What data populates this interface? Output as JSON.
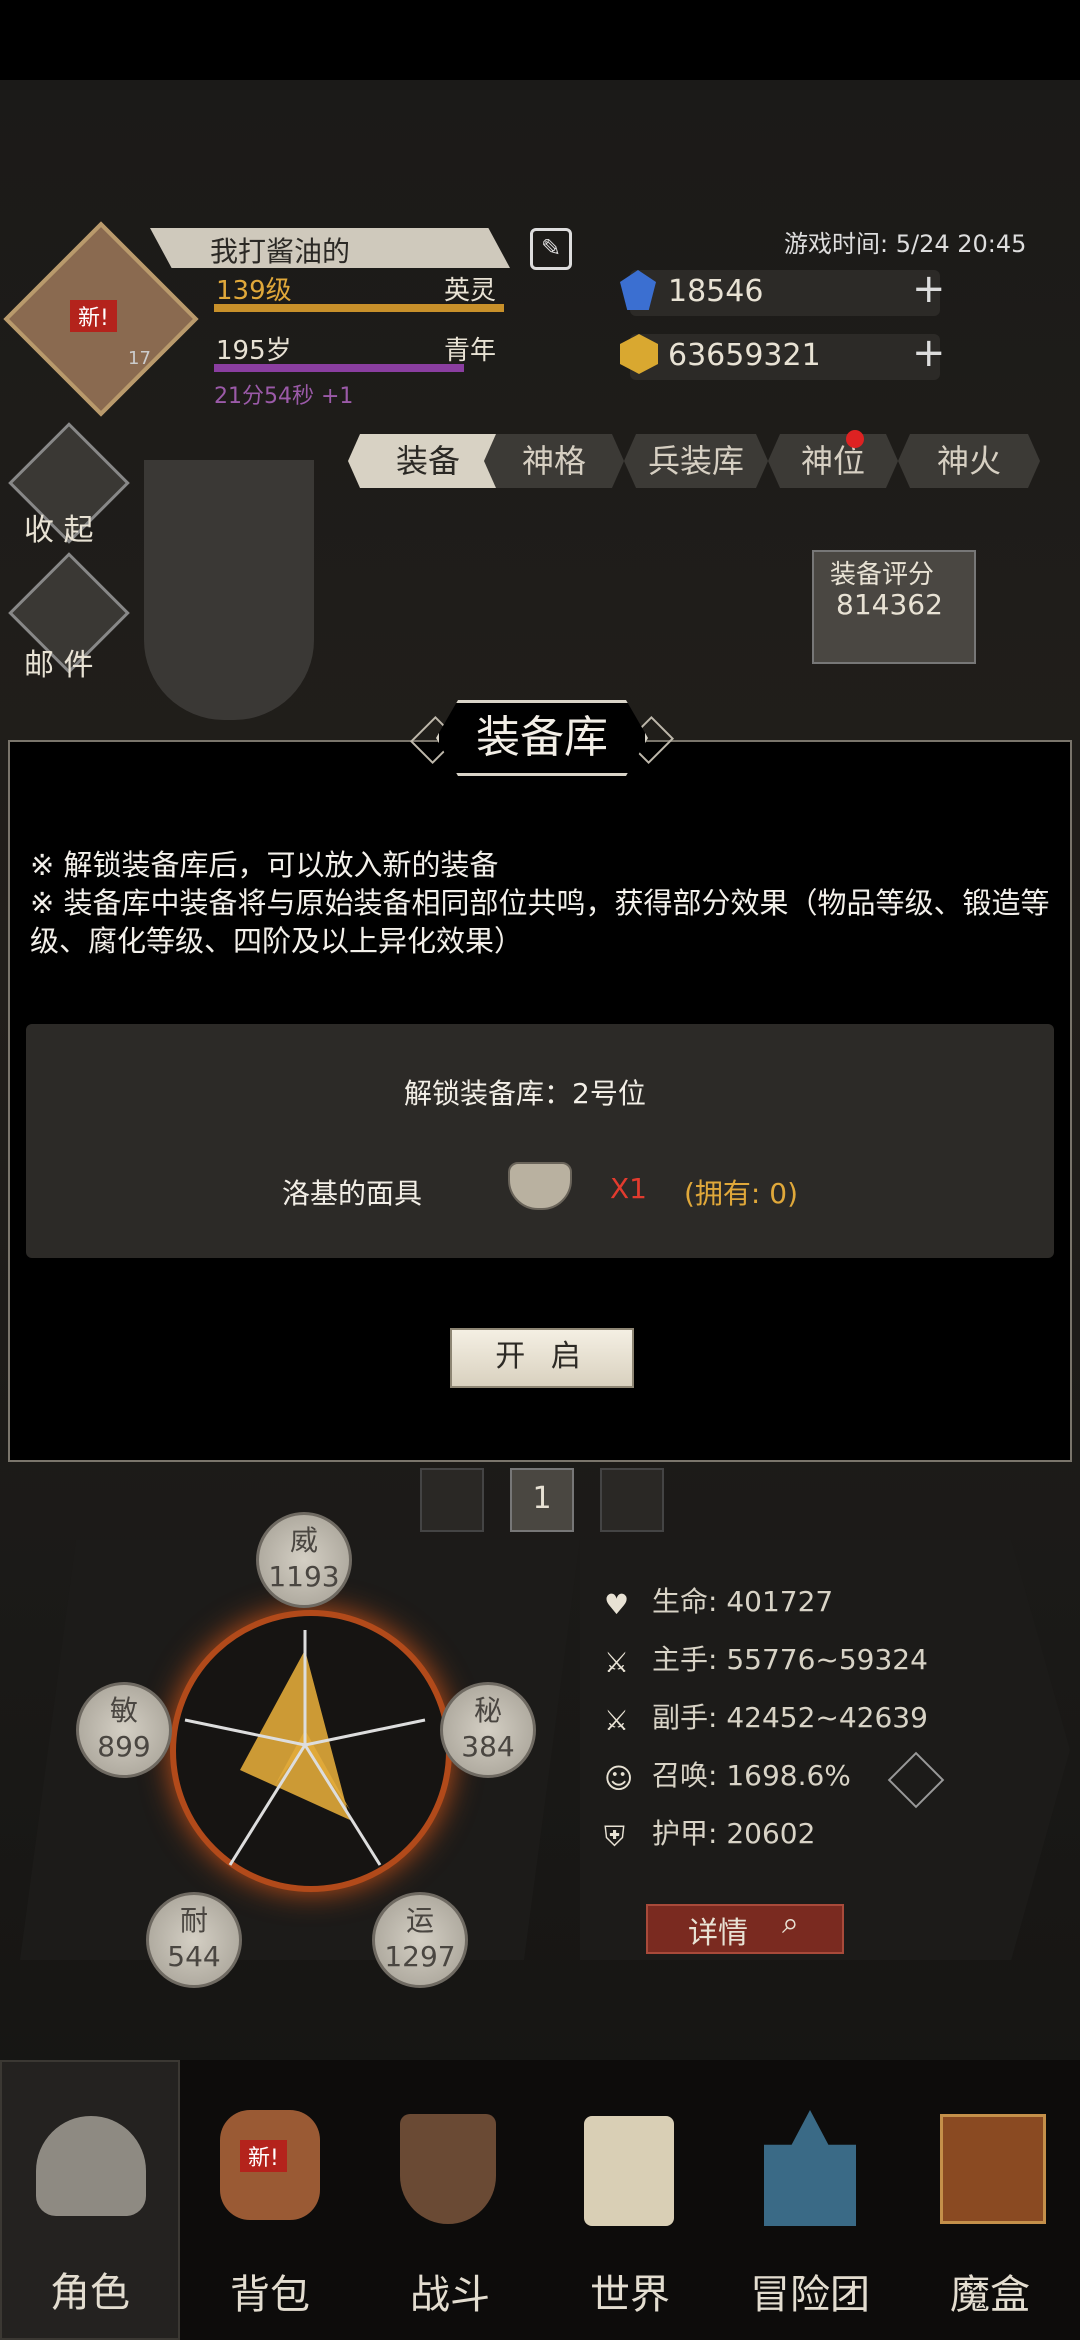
{
  "background": {
    "player_name": "我打酱油的",
    "level": "139级",
    "title": "英灵",
    "age": "195岁",
    "age_stage": "青年",
    "timer": "21分54秒 +1",
    "avatar_badge": "新!",
    "avatar_rank": "17",
    "game_time": "游戏时间: 5/24 20:45",
    "gems": "18546",
    "gold": "63659321",
    "side_buttons": [
      "收 起",
      "邮 件"
    ],
    "tabs": [
      "装备",
      "神格",
      "兵装库",
      "神位",
      "神火"
    ],
    "equip_score_label": "装备评分",
    "equip_score": "814362",
    "slot_number": "1",
    "stats": {
      "wei_label": "威",
      "wei": "1193",
      "mi_label": "秘",
      "mi": "384",
      "yun_label": "运",
      "yun": "1297",
      "nai_label": "耐",
      "nai": "544",
      "min_label": "敏",
      "min": "899"
    },
    "attributes": [
      {
        "label": "生命: 401727"
      },
      {
        "label": "主手: 55776~59324"
      },
      {
        "label": "副手: 42452~42639"
      },
      {
        "label": "召唤: 1698.6%"
      },
      {
        "label": "护甲: 20602"
      }
    ],
    "details_button": "详情"
  },
  "modal": {
    "title": "装备库",
    "note1": "※ 解锁装备库后，可以放入新的装备",
    "note2": "※ 装备库中装备将与原始装备相同部位共鸣，获得部分效果（物品等级、锻造等级、腐化等级、四阶及以上异化效果）",
    "unlock_text": "解锁装备库：2号位",
    "item_name": "洛基的面具",
    "item_qty": "X1",
    "owned": "(拥有: 0)",
    "open_button": "开 启"
  },
  "nav": {
    "items": [
      "角色",
      "背包",
      "战斗",
      "世界",
      "冒险团",
      "魔盒"
    ],
    "badge": "新!"
  },
  "colors": {
    "accent_gold": "#e0a83a",
    "xp_bar": "#c8902a",
    "age_bar": "#8a3ea0",
    "red_qty": "#e23b2e",
    "owned": "#e0a83a"
  }
}
